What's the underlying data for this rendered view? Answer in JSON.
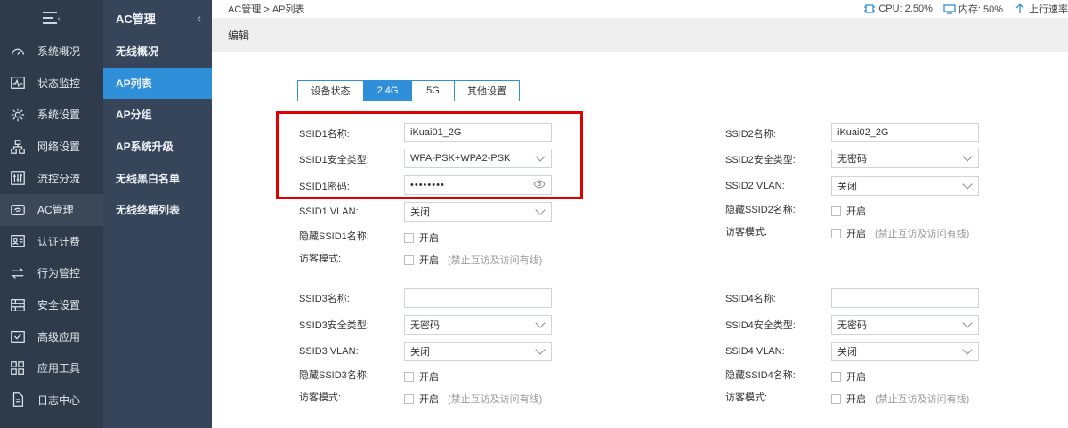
{
  "sidebar": {
    "items": [
      {
        "label": "系统概况",
        "icon": "gauge-icon"
      },
      {
        "label": "状态监控",
        "icon": "pulse-icon"
      },
      {
        "label": "系统设置",
        "icon": "gear-icon"
      },
      {
        "label": "网络设置",
        "icon": "network-icon"
      },
      {
        "label": "流控分流",
        "icon": "sliders-icon"
      },
      {
        "label": "AC管理",
        "icon": "wifi-icon"
      },
      {
        "label": "认证计费",
        "icon": "id-card-icon"
      },
      {
        "label": "行为管控",
        "icon": "arrows-icon"
      },
      {
        "label": "安全设置",
        "icon": "firewall-icon"
      },
      {
        "label": "高级应用",
        "icon": "checkbox-icon"
      },
      {
        "label": "应用工具",
        "icon": "apps-icon"
      },
      {
        "label": "日志中心",
        "icon": "document-icon"
      }
    ]
  },
  "subbar": {
    "title": "AC管理",
    "items": [
      "无线概况",
      "AP列表",
      "AP分组",
      "AP系统升级",
      "无线黑白名单",
      "无线终端列表"
    ]
  },
  "topbar": {
    "breadcrumb": "AC管理 > AP列表",
    "cpu": "CPU: 2.50%",
    "mem": "内存: 50%",
    "upload": "上行速率"
  },
  "page": {
    "title": "编辑"
  },
  "tabs": [
    "设备状态",
    "2.4G",
    "5G",
    "其他设置"
  ],
  "ssid1": {
    "name_label": "SSID1名称:",
    "name_value": "iKuai01_2G",
    "sec_label": "SSID1安全类型:",
    "sec_value": "WPA-PSK+WPA2-PSK",
    "pwd_label": "SSID1密码:",
    "pwd_value": "••••••••",
    "vlan_label": "SSID1 VLAN:",
    "vlan_value": "关闭",
    "hide_label": "隐藏SSID1名称:",
    "hide_opt": "开启",
    "guest_label": "访客模式:",
    "guest_opt": "开启",
    "guest_hint": "(禁止互访及访问有线)"
  },
  "ssid2": {
    "name_label": "SSID2名称:",
    "name_value": "iKuai02_2G",
    "sec_label": "SSID2安全类型:",
    "sec_value": "无密码",
    "vlan_label": "SSID2 VLAN:",
    "vlan_value": "关闭",
    "hide_label": "隐藏SSID2名称:",
    "hide_opt": "开启",
    "guest_label": "访客模式:",
    "guest_opt": "开启",
    "guest_hint": "(禁止互访及访问有线)"
  },
  "ssid3": {
    "name_label": "SSID3名称:",
    "name_value": "",
    "sec_label": "SSID3安全类型:",
    "sec_value": "无密码",
    "vlan_label": "SSID3 VLAN:",
    "vlan_value": "关闭",
    "hide_label": "隐藏SSID3名称:",
    "hide_opt": "开启",
    "guest_label": "访客模式:",
    "guest_opt": "开启",
    "guest_hint": "(禁止互访及访问有线)"
  },
  "ssid4": {
    "name_label": "SSID4名称:",
    "name_value": "",
    "sec_label": "SSID4安全类型:",
    "sec_value": "无密码",
    "vlan_label": "SSID4 VLAN:",
    "vlan_value": "关闭",
    "hide_label": "隐藏SSID4名称:",
    "hide_opt": "开启",
    "guest_label": "访客模式:",
    "guest_opt": "开启",
    "guest_hint": "(禁止互访及访问有线)"
  },
  "colors": {
    "accent": "#2f8fd8",
    "sidebar": "#2f3b4a",
    "highlight": "#e00000"
  }
}
